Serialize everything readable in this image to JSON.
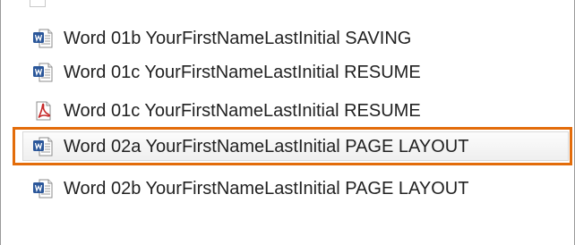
{
  "files": [
    {
      "name": "Word 01b YourFirstNameLastInitial SAVING",
      "type": "word-doc",
      "icon": "word-document-icon",
      "selected": false
    },
    {
      "name": "Word 01c YourFirstNameLastInitial RESUME",
      "type": "word-doc",
      "icon": "word-document-icon",
      "selected": false
    },
    {
      "name": "Word 01c YourFirstNameLastInitial RESUME",
      "type": "pdf",
      "icon": "pdf-document-icon",
      "selected": false
    },
    {
      "name": "Word 02a YourFirstNameLastInitial PAGE LAYOUT",
      "type": "word-doc",
      "icon": "word-document-icon",
      "selected": true
    },
    {
      "name": "Word 02b YourFirstNameLastInitial PAGE LAYOUT",
      "type": "word-doc",
      "icon": "word-document-icon",
      "selected": false
    }
  ],
  "colors": {
    "highlight_border": "#e36c0a",
    "word_blue": "#2b579a",
    "pdf_red": "#c62828",
    "text": "#222222"
  }
}
